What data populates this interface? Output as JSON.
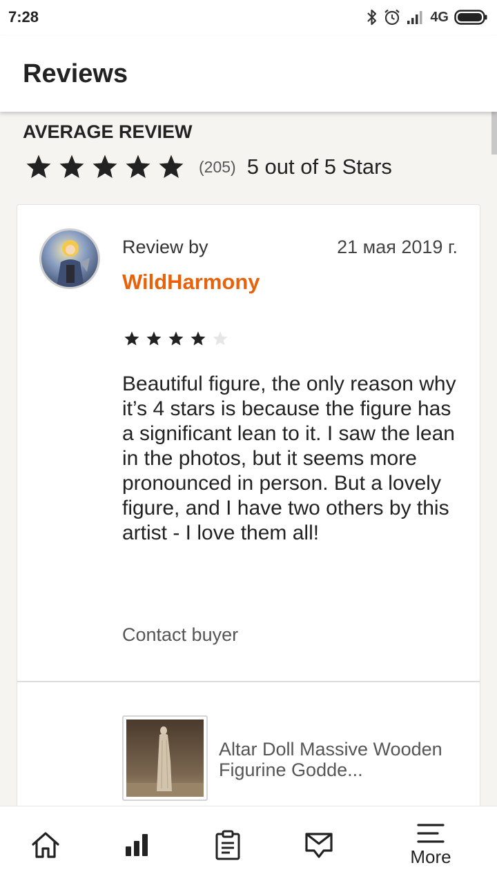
{
  "status_bar": {
    "time": "7:28",
    "network": "4G",
    "icons": [
      "bluetooth-icon",
      "alarm-icon",
      "signal-icon",
      "battery-icon"
    ]
  },
  "app_bar": {
    "title": "Reviews"
  },
  "average": {
    "heading": "AVERAGE REVIEW",
    "stars": 5,
    "count": "(205)",
    "text": "5 out of 5 Stars"
  },
  "review": {
    "by_label": "Review by",
    "date": "21 мая 2019 г.",
    "reviewer": "WildHarmony",
    "rating": 4,
    "max_rating": 5,
    "text": "Beautiful figure, the only reason why it’s 4 stars is because the figure has a significant lean to it. I saw the lean in the photos, but it seems more pronounced in person. But a lovely figure, and I have two others by this artist - I love them all!",
    "contact_label": "Contact buyer",
    "product_title": "Altar Doll Massive Wooden Figurine Godde..."
  },
  "bottom_nav": {
    "items": [
      "home-icon",
      "stats-icon",
      "orders-icon",
      "messages-icon",
      "more-menu-icon"
    ],
    "more_label": "More"
  },
  "colors": {
    "accent": "#e8620c",
    "background": "#f5f4f0",
    "star_filled": "#222222",
    "star_empty": "#e6e6e6"
  }
}
